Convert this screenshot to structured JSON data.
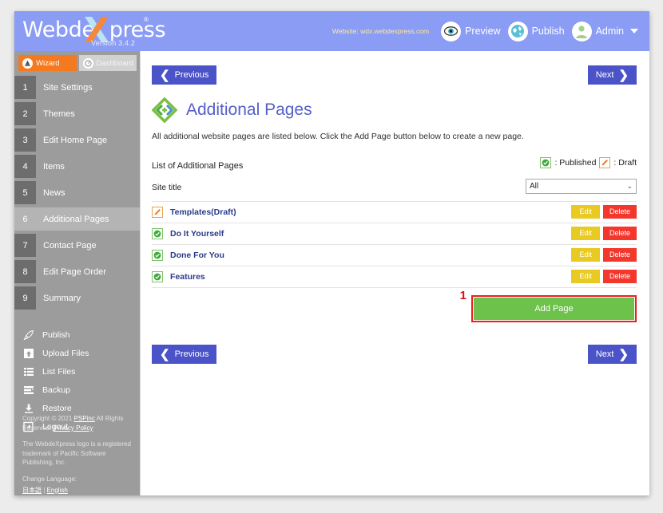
{
  "header": {
    "logo_text": "Webde",
    "logo_text2": "press",
    "logo_x": "X",
    "registered_mark": "®",
    "version": "Version 3.4.2",
    "site_url": "Website: wdx.webdexpress.com",
    "preview_label": "Preview",
    "publish_label": "Publish",
    "admin_label": "Admin",
    "brand_bg": "#8a9cf4"
  },
  "sidebar": {
    "tabs": [
      {
        "label": "Wizard",
        "icon": "wizard-hat-icon",
        "active": true
      },
      {
        "label": "Dashboard",
        "icon": "gauge-icon",
        "active": false
      }
    ],
    "items": [
      {
        "num": "1",
        "label": "Site Settings",
        "active": false
      },
      {
        "num": "2",
        "label": "Themes",
        "active": false
      },
      {
        "num": "3",
        "label": "Edit Home Page",
        "active": false
      },
      {
        "num": "4",
        "label": "Items",
        "active": false
      },
      {
        "num": "5",
        "label": "News",
        "active": false
      },
      {
        "num": "6",
        "label": "Additional Pages",
        "active": true
      },
      {
        "num": "7",
        "label": "Contact Page",
        "active": false
      },
      {
        "num": "8",
        "label": "Edit Page Order",
        "active": false
      },
      {
        "num": "9",
        "label": "Summary",
        "active": false
      }
    ],
    "tools": [
      {
        "label": "Publish",
        "icon": "rocket-icon"
      },
      {
        "label": "Upload Files",
        "icon": "upload-icon"
      },
      {
        "label": "List Files",
        "icon": "list-icon"
      },
      {
        "label": "Backup",
        "icon": "backup-icon"
      },
      {
        "label": "Restore",
        "icon": "download-icon"
      },
      {
        "label": "Logout",
        "icon": "logout-icon"
      }
    ],
    "footer": {
      "copyright_pre": "Copyright © 2021 ",
      "copyright_link": "PSPinc",
      "copyright_mid": " All Rights Reserved. ",
      "privacy_link": "Privacy Policy",
      "trademark": "The WebdeXpress logo is a registered trademark of Pacific Software Publishing, Inc.",
      "change_language": "Change Language:",
      "lang_ja": "日本語",
      "lang_sep": " | ",
      "lang_en": "English"
    }
  },
  "main": {
    "nav_prev": "Previous",
    "nav_next": "Next",
    "page_title": "Additional Pages",
    "page_icon": "code-diamond-icon",
    "page_desc": "All additional website pages are listed below. Click the Add Page button below to create a new page.",
    "list_title": "List of Additional Pages",
    "legend": {
      "published": ": Published",
      "draft": ": Draft"
    },
    "filter_label": "Site title",
    "filter_value": "All",
    "rows": [
      {
        "label": "Templates(Draft)",
        "status": "draft",
        "edit": "Edit",
        "delete": "Delete"
      },
      {
        "label": "Do It Yourself",
        "status": "published",
        "edit": "Edit",
        "delete": "Delete"
      },
      {
        "label": "Done For You",
        "status": "published",
        "edit": "Edit",
        "delete": "Delete"
      },
      {
        "label": "Features",
        "status": "published",
        "edit": "Edit",
        "delete": "Delete"
      }
    ],
    "add_button": "Add Page",
    "step_marker": "1",
    "highlight_color": "#ef1d1d"
  }
}
